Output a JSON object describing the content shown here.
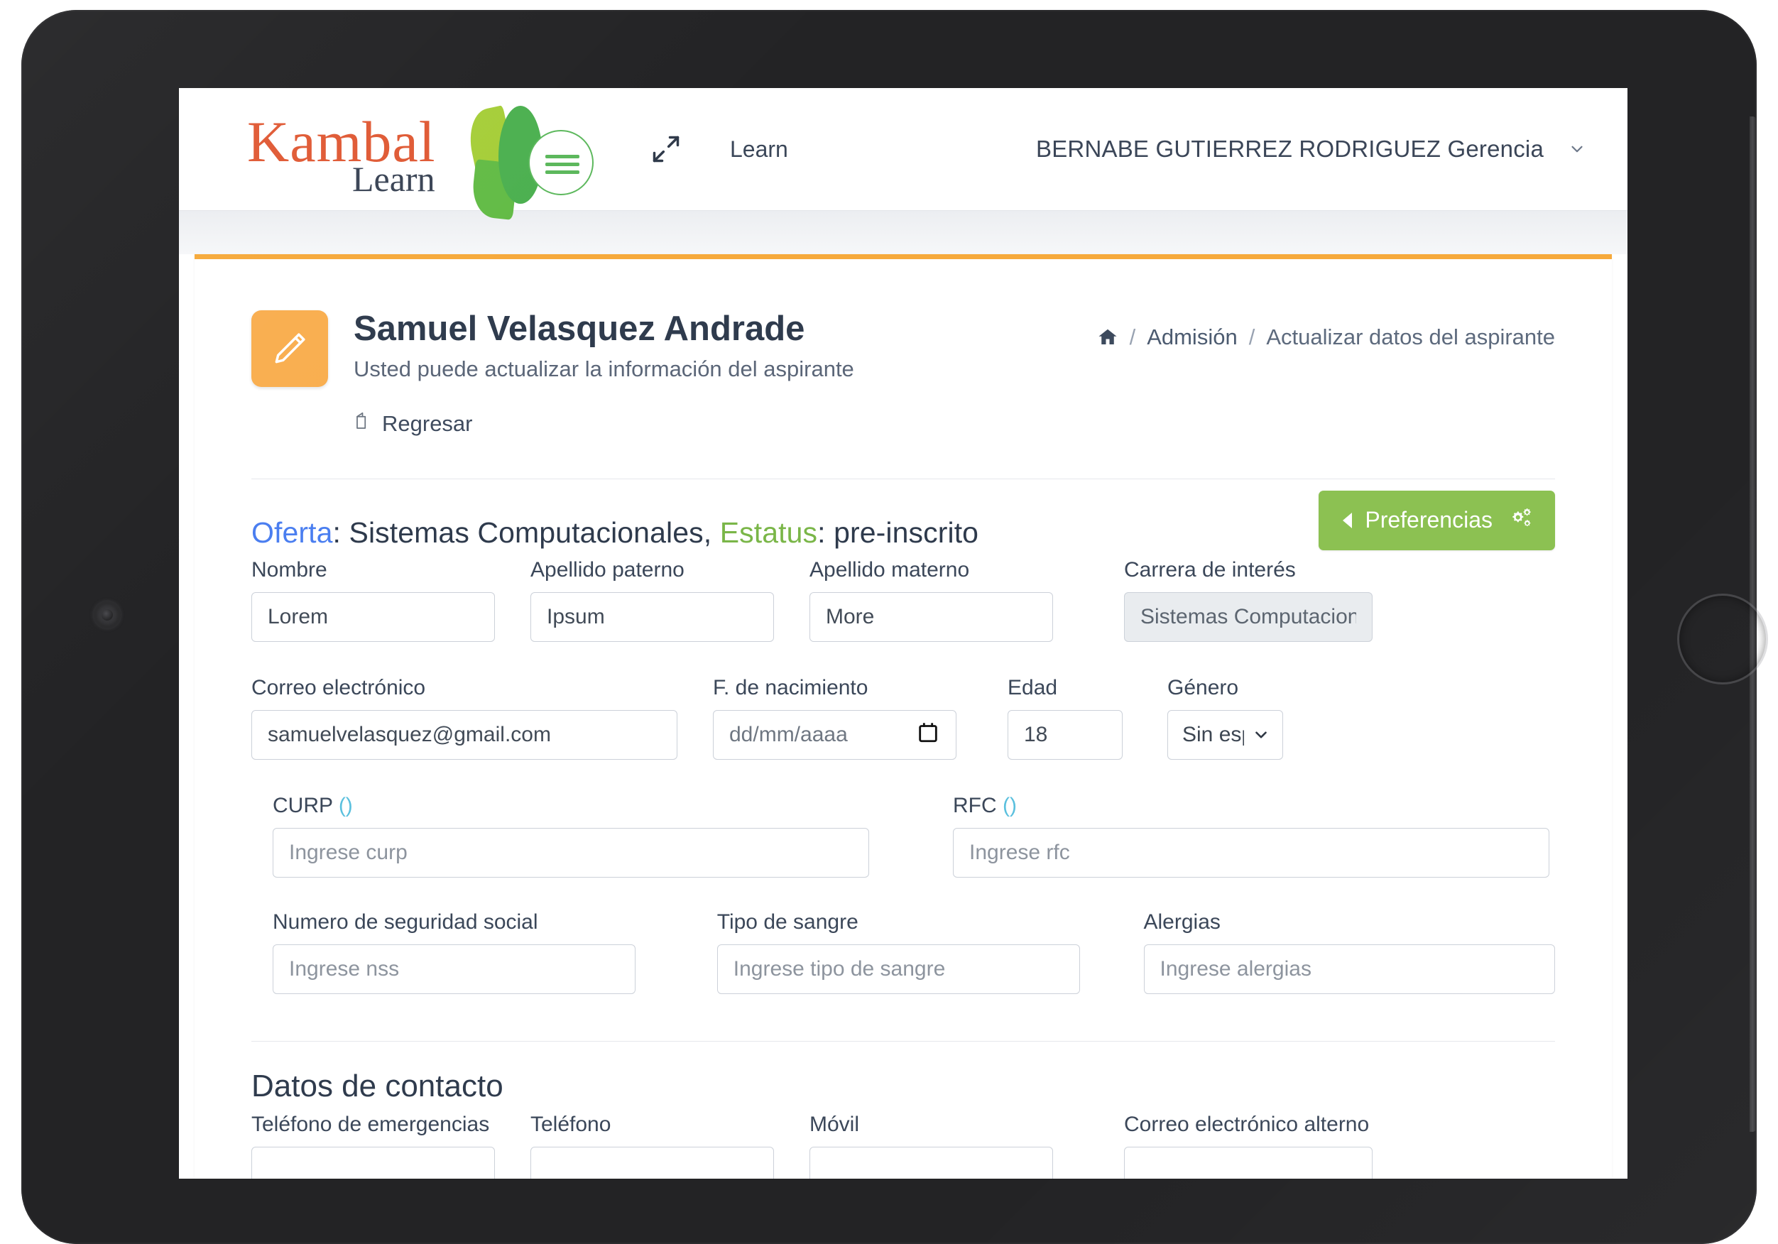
{
  "brand": {
    "name_primary": "Kambal",
    "name_secondary": "Learn",
    "logo_icon": "leaf-logo-icon"
  },
  "navbar": {
    "expand_icon": "expand-arrows-icon",
    "nav_link": "Learn",
    "user_name": "BERNABE GUTIERREZ RODRIGUEZ Gerencia",
    "user_chevron_icon": "chevron-down-icon"
  },
  "page": {
    "badge_icon": "pencil-edit-icon",
    "title": "Samuel Velasquez Andrade",
    "subtitle": "Usted puede actualizar la información del aspirante",
    "back_label": "Regresar",
    "back_icon": "back-arrow-icon"
  },
  "breadcrumb": {
    "home_icon": "home-icon",
    "sep": "/",
    "items": [
      {
        "label": "Admisión"
      },
      {
        "label": "Actualizar datos del aspirante"
      }
    ]
  },
  "toolbar": {
    "preferencias_label": "Preferencias",
    "preferencias_icon": "cogs-icon",
    "preferencias_caret_icon": "caret-left-icon",
    "preferencias_color": "#8CC152"
  },
  "offer": {
    "oferta_label": "Oferta",
    "oferta_sep": ": ",
    "oferta_value": "Sistemas Computacionales, ",
    "estatus_label": "Estatus",
    "estatus_sep": ": ",
    "estatus_value": "pre-inscrito",
    "oferta_color": "#4a7ef0",
    "estatus_color": "#7ab648"
  },
  "form": {
    "nombre": {
      "label": "Nombre",
      "value": "Lorem"
    },
    "paterno": {
      "label": "Apellido paterno",
      "value": "Ipsum"
    },
    "materno": {
      "label": "Apellido materno",
      "value": "More"
    },
    "carrera": {
      "label": "Carrera de interés",
      "value": "Sistemas Computacionales",
      "disabled": true
    },
    "email": {
      "label": "Correo electrónico",
      "value": "samuelvelasquez@gmail.com"
    },
    "fnac": {
      "label": "F. de nacimiento",
      "value": "dd/mm/aaaa",
      "icon": "calendar-icon"
    },
    "edad": {
      "label": "Edad",
      "value": "18"
    },
    "genero": {
      "label": "Género",
      "value": "Sin especificar",
      "options": [
        "Sin especificar"
      ]
    },
    "curp": {
      "label": "CURP ",
      "paren": "()",
      "placeholder": "Ingrese curp",
      "value": ""
    },
    "rfc": {
      "label": "RFC ",
      "paren": "()",
      "placeholder": "Ingrese rfc",
      "value": ""
    },
    "nss": {
      "label": "Numero de seguridad social",
      "placeholder": "Ingrese nss",
      "value": ""
    },
    "sangre": {
      "label": "Tipo de sangre",
      "placeholder": "Ingrese tipo de sangre",
      "value": ""
    },
    "alergias": {
      "label": "Alergias",
      "placeholder": "Ingrese alergias",
      "value": ""
    }
  },
  "contact": {
    "section_title": "Datos de contacto",
    "tel_emergencias": {
      "label": "Teléfono de emergencias",
      "value": ""
    },
    "telefono": {
      "label": "Teléfono",
      "value": ""
    },
    "movil": {
      "label": "Móvil",
      "value": ""
    },
    "email_alterno": {
      "label": "Correo electrónico alterno",
      "value": ""
    }
  }
}
